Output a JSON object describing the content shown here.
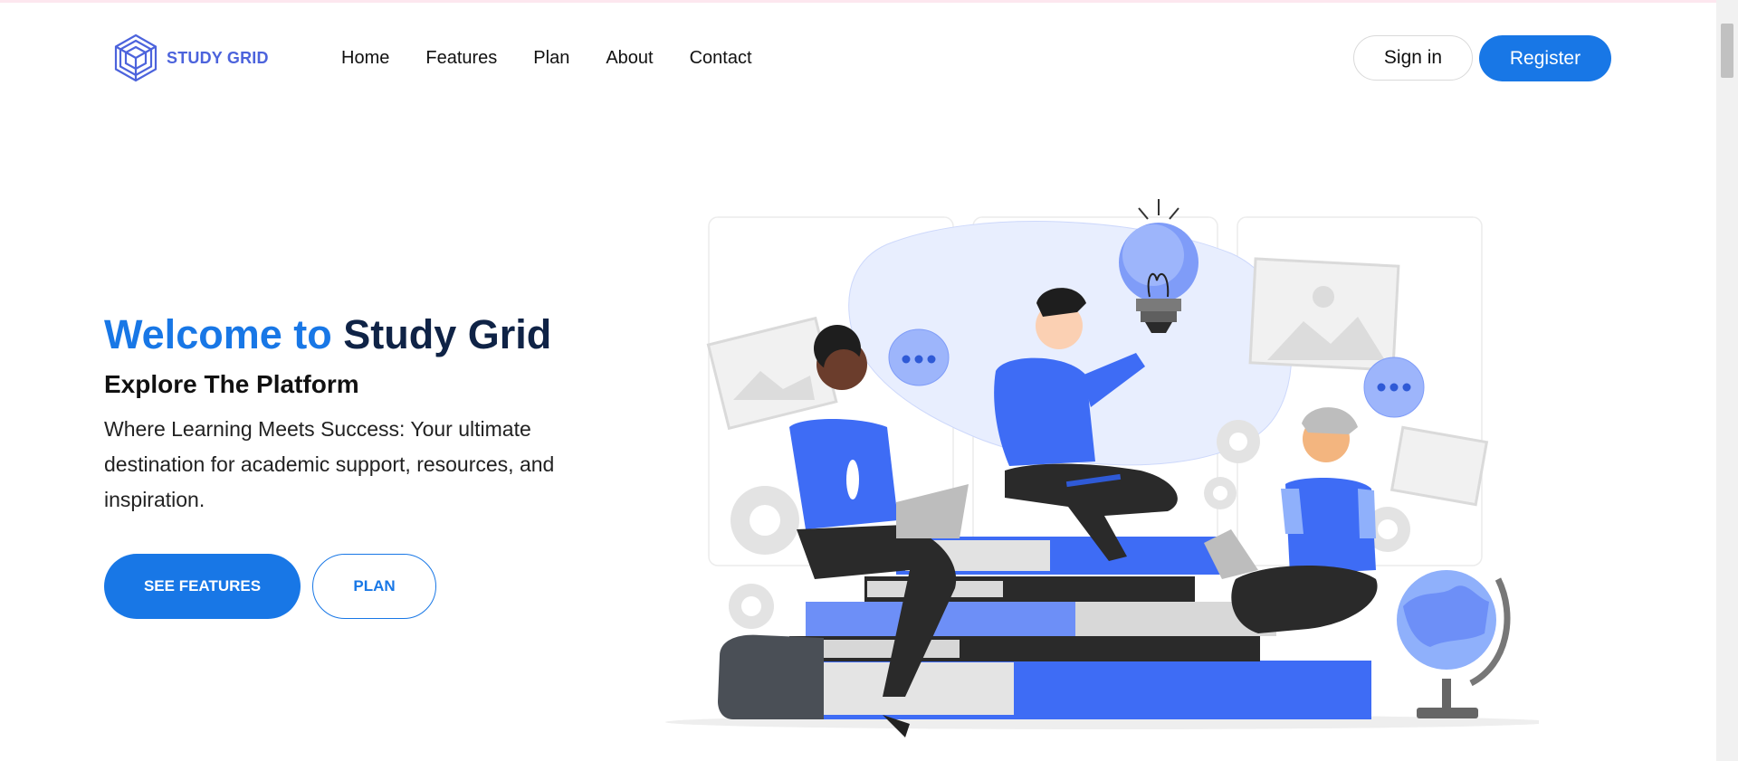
{
  "brand": {
    "name": "STUDY GRID",
    "accent": "#1877e6",
    "logo_color": "#4c63dc"
  },
  "nav": {
    "items": [
      {
        "label": "Home"
      },
      {
        "label": "Features"
      },
      {
        "label": "Plan"
      },
      {
        "label": "About"
      },
      {
        "label": "Contact"
      }
    ]
  },
  "auth": {
    "signin_label": "Sign in",
    "register_label": "Register"
  },
  "hero": {
    "title_part1": "Welcome to",
    "title_part2": "Study Grid",
    "subtitle": "Explore The Platform",
    "description": "Where Learning Meets Success: Your ultimate destination for academic support, resources, and inspiration.",
    "primary_cta": "SEE FEATURES",
    "secondary_cta": "PLAN"
  },
  "illustration": {
    "icon": "students-studying-illustration"
  }
}
